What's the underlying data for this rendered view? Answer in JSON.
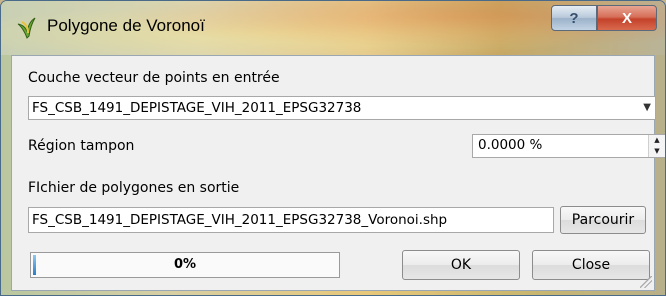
{
  "window": {
    "title": "Polygone de Voronoï",
    "help_label": "?",
    "close_label": "X"
  },
  "input_layer": {
    "label": "Couche vecteur de points en entrée",
    "selected": "FS_CSB_1491_DEPISTAGE_VIH_2011_EPSG32738"
  },
  "buffer": {
    "label": "Région tampon",
    "value": "0.0000 %"
  },
  "output_file": {
    "label": "FIchier de polygones en sortie",
    "value": "FS_CSB_1491_DEPISTAGE_VIH_2011_EPSG32738_Voronoi.shp",
    "browse_label": "Parcourir"
  },
  "progress": {
    "text": "0%",
    "value": 0
  },
  "buttons": {
    "ok_label": "OK",
    "close_label": "Close"
  }
}
